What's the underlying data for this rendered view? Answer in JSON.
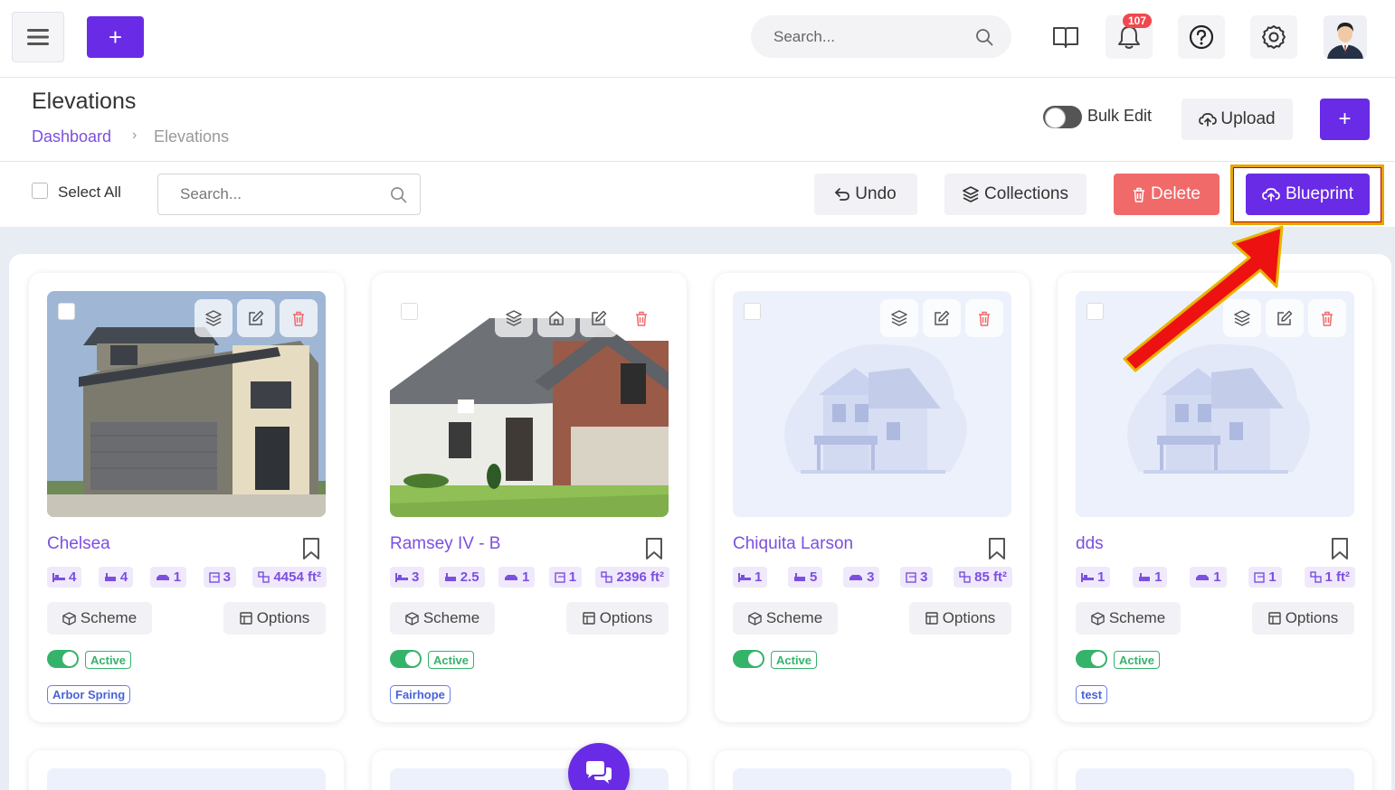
{
  "topbar": {
    "add_label": "+",
    "search_placeholder": "Search...",
    "notification_count": "107"
  },
  "header": {
    "title": "Elevations",
    "breadcrumb": {
      "home": "Dashboard",
      "separator": "›",
      "current": "Elevations"
    },
    "bulk_edit_label": "Bulk Edit",
    "upload_label": "Upload",
    "add_label": "+"
  },
  "toolbar": {
    "select_all_label": "Select All",
    "search_placeholder": "Search...",
    "undo_label": "Undo",
    "collections_label": "Collections",
    "delete_label": "Delete",
    "blueprint_label": "Blueprint"
  },
  "cards": [
    {
      "name": "Chelsea",
      "stats": [
        "4",
        "4",
        "1",
        "3",
        "4454 ft²"
      ],
      "scheme": "Scheme",
      "options": "Options",
      "status": "Active",
      "community": "Arbor Spring"
    },
    {
      "name": "Ramsey IV - B",
      "stats": [
        "3",
        "2.5",
        "1",
        "1",
        "2396 ft²"
      ],
      "scheme": "Scheme",
      "options": "Options",
      "status": "Active",
      "community": "Fairhope"
    },
    {
      "name": "Chiquita Larson",
      "stats": [
        "1",
        "5",
        "3",
        "3",
        "85 ft²"
      ],
      "scheme": "Scheme",
      "options": "Options",
      "status": "Active",
      "community": ""
    },
    {
      "name": "dds",
      "stats": [
        "1",
        "1",
        "1",
        "1",
        "1 ft²"
      ],
      "scheme": "Scheme",
      "options": "Options",
      "status": "Active",
      "community": "test"
    }
  ],
  "colors": {
    "primary": "#6a2be6",
    "danger": "#f16a6a",
    "success": "#35b36b",
    "link": "#7c4fe0",
    "annotation_arrow": "#ee1111",
    "annotation_outline": "#e8a400"
  }
}
